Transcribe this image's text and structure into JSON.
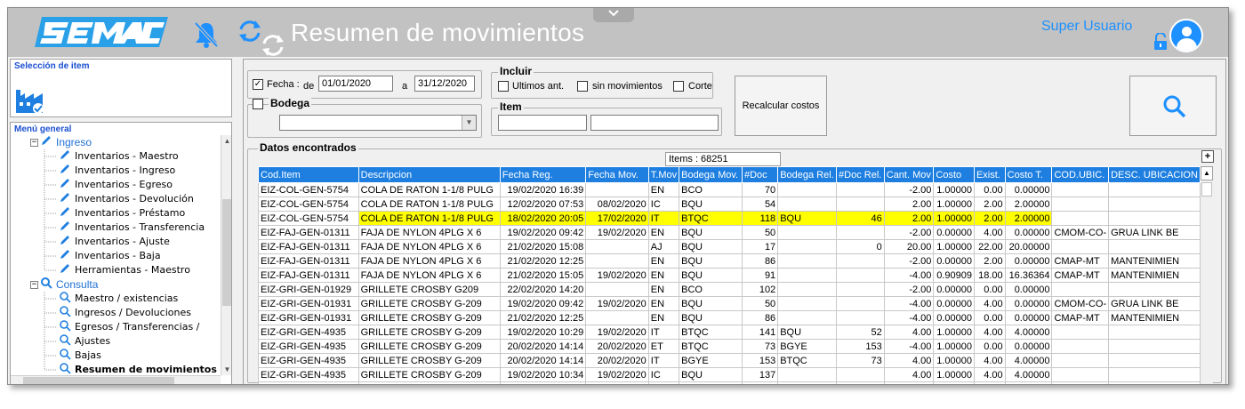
{
  "header": {
    "title": "Resumen de movimientos",
    "user": "Super Usuario",
    "brand_color": "#1e90ff",
    "accent_color": "#1e7fe0"
  },
  "icons": [
    "semac-logo",
    "bell-off-icon",
    "sync-icon",
    "chevron-down-icon",
    "unlock-icon",
    "user-avatar-icon",
    "factory-icon",
    "search-icon"
  ],
  "selection_panel": {
    "title": "Selección de item"
  },
  "menu": {
    "title": "Menú general",
    "groups": [
      {
        "label": "Ingreso",
        "items": [
          "Inventarios - Maestro",
          "Inventarios - Ingreso",
          "Inventarios - Egreso",
          "Inventarios - Devolución",
          "Inventarios - Préstamo",
          "Inventarios - Transferencia",
          "Inventarios - Ajuste",
          "Inventarios - Baja",
          "Herramientas - Maestro"
        ]
      },
      {
        "label": "Consulta",
        "items": [
          "Maestro / existencias",
          "Ingresos / Devoluciones",
          "Egresos / Transferencias /",
          "Ajustes",
          "Bajas",
          "Resumen de movimientos"
        ]
      }
    ],
    "selected": "Resumen de movimientos"
  },
  "filters": {
    "fecha_label": "Fecha :",
    "de_label": "de",
    "a_label": "a",
    "fecha_checked": true,
    "fecha_desde": "01/01/2020",
    "fecha_hasta": "31/12/2020",
    "incluir_title": "Incluir",
    "ultimos_label": "Ultimos ant.",
    "sin_mov_label": "sin movimientos",
    "corte_label": "Corte",
    "bodega_label": "Bodega",
    "bodega_value": "",
    "item_title": "Item",
    "item_code": "",
    "item_desc": "",
    "recalc_label": "Recalcular costos"
  },
  "results": {
    "title": "Datos encontrados",
    "items_count": "Items : 68251",
    "expand_label": "+",
    "columns": [
      "Cod.Item",
      "Descripcion",
      "Fecha Reg.",
      "Fecha Mov.",
      "T.Mov",
      "Bodega Mov.",
      "#Doc",
      "Bodega Rel.",
      "#Doc Rel.",
      "Cant. Mov",
      "Costo",
      "Exist.",
      "Costo T.",
      "COD.UBIC.",
      "DESC. UBICACION"
    ],
    "rows": [
      [
        "EIZ-COL-GEN-5754",
        "COLA DE RATON 1-1/8 PULG",
        "19/02/2020 16:39",
        "",
        "EN",
        "BCO",
        "70",
        "",
        "",
        "-2.00",
        "1.00000",
        "0.00",
        "0.00000",
        "",
        ""
      ],
      [
        "EIZ-COL-GEN-5754",
        "COLA DE RATON 1-1/8 PULG",
        "12/02/2020 07:53",
        "08/02/2020",
        "IC",
        "BQU",
        "54",
        "",
        "",
        "2.00",
        "1.00000",
        "2.00",
        "2.00000",
        "",
        ""
      ],
      [
        "EIZ-COL-GEN-5754",
        "COLA DE RATON 1-1/8 PULG",
        "18/02/2020 20:05",
        "17/02/2020",
        "IT",
        "BTQC",
        "118",
        "BQU",
        "46",
        "2.00",
        "1.00000",
        "2.00",
        "2.00000",
        "",
        ""
      ],
      [
        "EIZ-FAJ-GEN-01311",
        "FAJA DE NYLON 4PLG X 6",
        "19/02/2020 09:42",
        "19/02/2020",
        "EN",
        "BQU",
        "50",
        "",
        "",
        "-2.00",
        "0.00000",
        "4.00",
        "0.00000",
        "CMOM-CO-",
        "GRUA LINK BE"
      ],
      [
        "EIZ-FAJ-GEN-01311",
        "FAJA DE NYLON 4PLG X 6",
        "21/02/2020 15:08",
        "",
        "AJ",
        "BQU",
        "17",
        "",
        "0",
        "20.00",
        "1.00000",
        "22.00",
        "20.00000",
        "",
        ""
      ],
      [
        "EIZ-FAJ-GEN-01311",
        "FAJA DE NYLON 4PLG X 6",
        "21/02/2020 12:25",
        "",
        "EN",
        "BQU",
        "86",
        "",
        "",
        "-2.00",
        "0.00000",
        "2.00",
        "0.00000",
        "CMAP-MT",
        "MANTENIMIEN"
      ],
      [
        "EIZ-FAJ-GEN-01311",
        "FAJA DE NYLON 4PLG X 6",
        "21/02/2020 15:05",
        "19/02/2020",
        "EN",
        "BQU",
        "91",
        "",
        "",
        "-4.00",
        "0.90909",
        "18.00",
        "16.36364",
        "CMAP-MT",
        "MANTENIMIEN"
      ],
      [
        "EIZ-GRI-GEN-01929",
        "GRILLETE CROSBY G209",
        "22/02/2020 14:20",
        "",
        "EN",
        "BCO",
        "102",
        "",
        "",
        "-2.00",
        "0.00000",
        "0.00",
        "0.00000",
        "",
        ""
      ],
      [
        "EIZ-GRI-GEN-01931",
        "GRILLETE CROSBY G-209",
        "19/02/2020 09:42",
        "19/02/2020",
        "EN",
        "BQU",
        "50",
        "",
        "",
        "-4.00",
        "0.00000",
        "4.00",
        "0.00000",
        "CMOM-CO-",
        "GRUA LINK BE"
      ],
      [
        "EIZ-GRI-GEN-01931",
        "GRILLETE CROSBY G-209",
        "21/02/2020 12:25",
        "",
        "EN",
        "BQU",
        "86",
        "",
        "",
        "-4.00",
        "0.00000",
        "0.00",
        "0.00000",
        "CMAP-MT",
        "MANTENIMIEN"
      ],
      [
        "EIZ-GRI-GEN-4935",
        "GRILLETE CROSBY G-209",
        "19/02/2020 10:29",
        "19/02/2020",
        "IT",
        "BTQC",
        "141",
        "BQU",
        "52",
        "4.00",
        "1.00000",
        "4.00",
        "4.00000",
        "",
        ""
      ],
      [
        "EIZ-GRI-GEN-4935",
        "GRILLETE CROSBY G-209",
        "20/02/2020 14:14",
        "20/02/2020",
        "ET",
        "BTQC",
        "73",
        "BGYE",
        "153",
        "-4.00",
        "1.00000",
        "0.00",
        "0.00000",
        "",
        ""
      ],
      [
        "EIZ-GRI-GEN-4935",
        "GRILLETE CROSBY G-209",
        "20/02/2020 14:14",
        "20/02/2020",
        "IT",
        "BGYE",
        "153",
        "BTQC",
        "73",
        "4.00",
        "1.00000",
        "4.00",
        "4.00000",
        "",
        ""
      ],
      [
        "EIZ-GRI-GEN-4935",
        "GRILLETE CROSBY G-209",
        "19/02/2020 10:34",
        "19/02/2020",
        "IC",
        "BQU",
        "137",
        "",
        "",
        "4.00",
        "1.00000",
        "4.00",
        "4.00000",
        "",
        ""
      ],
      [
        "EIZ-GRI-GEN-4935",
        "GRILLETE CROSBY G-209",
        "19/02/2020 10:29",
        "19/02/2020",
        "ET",
        "BQU",
        "52",
        "BTQC",
        "141",
        "-4.00",
        "1.00000",
        "0.00",
        "0.00000",
        "",
        ""
      ]
    ],
    "highlight_row": 2,
    "highlight_color": "#ffff00"
  }
}
